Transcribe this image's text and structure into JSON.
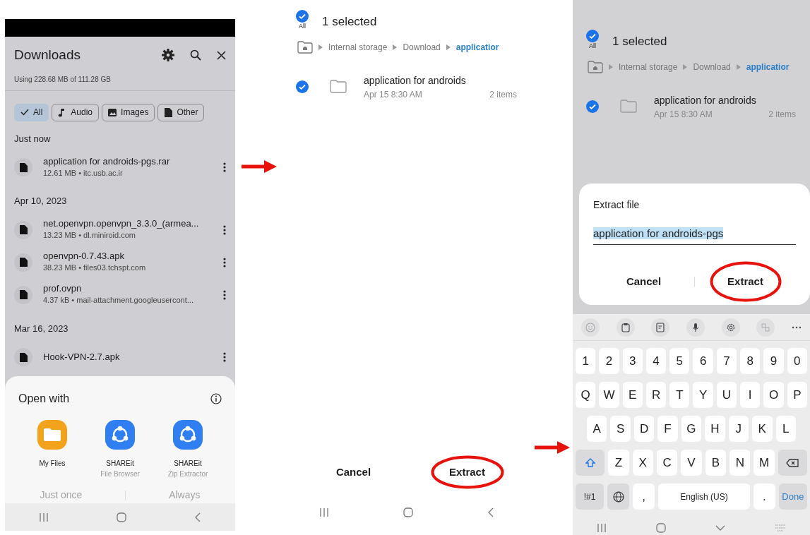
{
  "downloads_screen": {
    "title": "Downloads",
    "storage": "Using 228.68 MB of 111.28 GB",
    "filters": [
      {
        "label": "All",
        "selected": true
      },
      {
        "label": "Audio",
        "selected": false
      },
      {
        "label": "Images",
        "selected": false
      },
      {
        "label": "Other",
        "selected": false
      }
    ],
    "groups": [
      {
        "heading": "Just now",
        "files": [
          {
            "name": "application for androids-pgs.rar",
            "meta": "12.61 MB • itc.usb.ac.ir"
          }
        ]
      },
      {
        "heading": "Apr 10, 2023",
        "files": [
          {
            "name": "net.openvpn.openvpn_3.3.0_(armea...",
            "meta": "13.23 MB • dl.miniroid.com"
          },
          {
            "name": "openvpn-0.7.43.apk",
            "meta": "38.23 MB • files03.tchspt.com"
          },
          {
            "name": "prof.ovpn",
            "meta": "4.37 kB • mail-attachment.googleusercont..."
          }
        ]
      },
      {
        "heading": "Mar 16, 2023",
        "files": [
          {
            "name": "Hook-VPN-2.7.apk"
          }
        ]
      }
    ],
    "open_with": {
      "title": "Open with",
      "apps": [
        {
          "kind": "folder",
          "name": "My Files"
        },
        {
          "kind": "share",
          "name": "SHAREit",
          "subtitle": "File Browser"
        },
        {
          "kind": "share",
          "name": "SHAREit",
          "subtitle": "Zip Extractor"
        }
      ],
      "actions": [
        {
          "label": "Just once",
          "disabled": true
        },
        {
          "label": "Always",
          "disabled": true
        }
      ]
    }
  },
  "selection_screen": {
    "all_label": "All",
    "all_checked": true,
    "title": "1 selected",
    "breadcrumb": [
      {
        "label": "Internal storage",
        "current": false
      },
      {
        "label": "Download",
        "current": false
      },
      {
        "label": "applicatior",
        "current": true
      }
    ],
    "items": [
      {
        "name": "application for androids",
        "date": "Apr 15 8:30 AM",
        "count": "2 items",
        "checked": true
      }
    ],
    "buttons": [
      {
        "label": "Cancel",
        "circled": false
      },
      {
        "label": "Extract",
        "circled": true
      }
    ]
  },
  "extract_screen": {
    "all_label": "All",
    "all_checked": true,
    "title": "1 selected",
    "breadcrumb": [
      {
        "label": "Internal storage",
        "current": false
      },
      {
        "label": "Download",
        "current": false
      },
      {
        "label": "applicatior",
        "current": true
      }
    ],
    "items": [
      {
        "name": "application for androids",
        "date": "Apr 15 8:30 AM",
        "count": "2 items",
        "checked": true
      }
    ],
    "dialog": {
      "title": "Extract file",
      "value": "application for androids-pgs",
      "value_selected": true,
      "buttons": [
        {
          "label": "Cancel",
          "circled": false
        },
        {
          "label": "Extract",
          "circled": true
        }
      ]
    },
    "keyboard": {
      "rows": [
        {
          "keys": [
            "1",
            "2",
            "3",
            "4",
            "5",
            "6",
            "7",
            "8",
            "9",
            "0"
          ]
        },
        {
          "keys": [
            "Q",
            "W",
            "E",
            "R",
            "T",
            "Y",
            "U",
            "I",
            "O",
            "P"
          ]
        },
        {
          "keys": [
            "A",
            "S",
            "D",
            "F",
            "G",
            "H",
            "J",
            "K",
            "L"
          ]
        },
        {
          "keys": [
            {
              "kind": "shift"
            },
            "Z",
            "X",
            "C",
            "V",
            "B",
            "N",
            "M",
            {
              "kind": "backspace"
            }
          ]
        },
        {
          "keys": [
            {
              "kind": "mode",
              "label": "!#1"
            },
            {
              "kind": "globe"
            },
            ",",
            {
              "kind": "space",
              "label": "English (US)"
            },
            ".",
            {
              "kind": "done",
              "label": "Done"
            }
          ]
        }
      ]
    }
  }
}
